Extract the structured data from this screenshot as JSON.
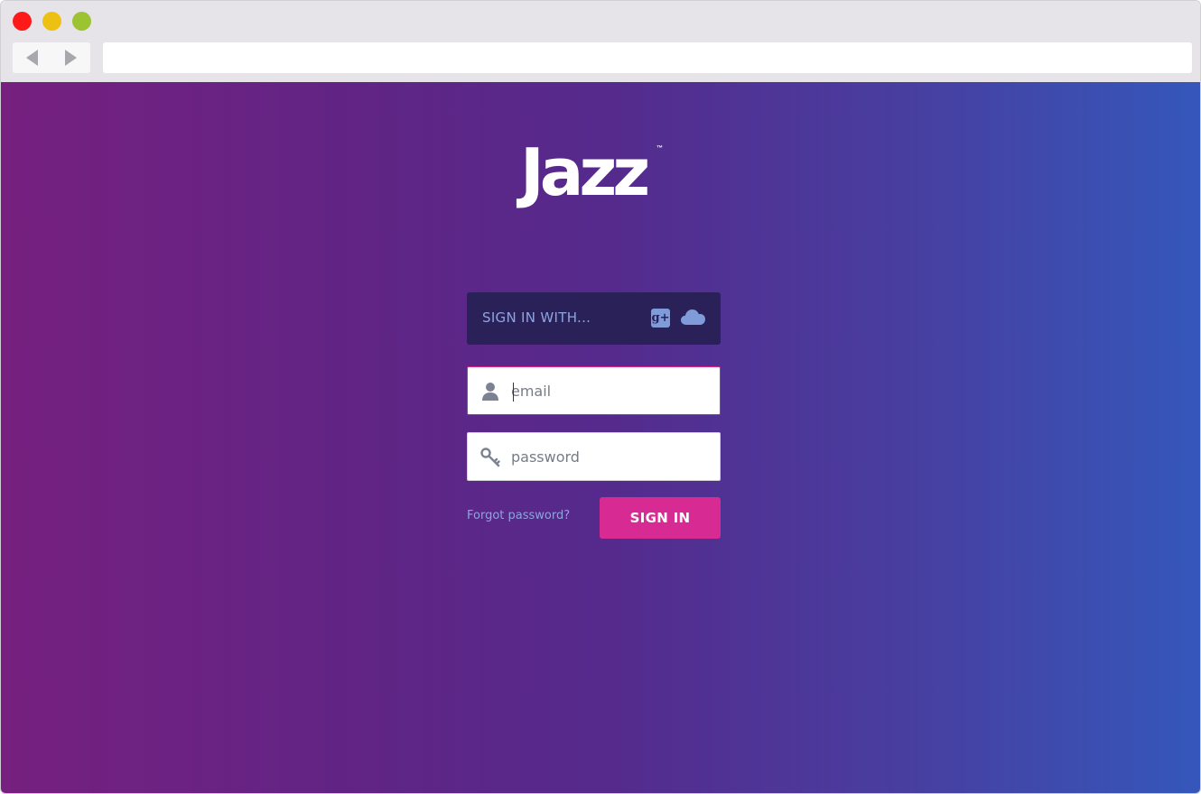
{
  "browser": {
    "url": "",
    "colors": {
      "close": "#ff1a1a",
      "minimize": "#ecc114",
      "zoom": "#9cc332"
    }
  },
  "brand": {
    "logo_text": "Jazz",
    "trademark": "™"
  },
  "social_signin": {
    "label": "SIGN IN WITH...",
    "providers": [
      {
        "icon": "google-plus-icon",
        "glyph": "g+"
      },
      {
        "icon": "cloud-icon"
      }
    ]
  },
  "form": {
    "email": {
      "value": "",
      "placeholder": "email",
      "icon": "user-icon"
    },
    "password": {
      "value": "",
      "placeholder": "password",
      "icon": "key-icon"
    },
    "forgot_label": "Forgot password?",
    "submit_label": "SIGN IN"
  },
  "colors": {
    "accent": "#d82a93",
    "social_panel": "#2a2158",
    "link": "#8fa4e0"
  }
}
